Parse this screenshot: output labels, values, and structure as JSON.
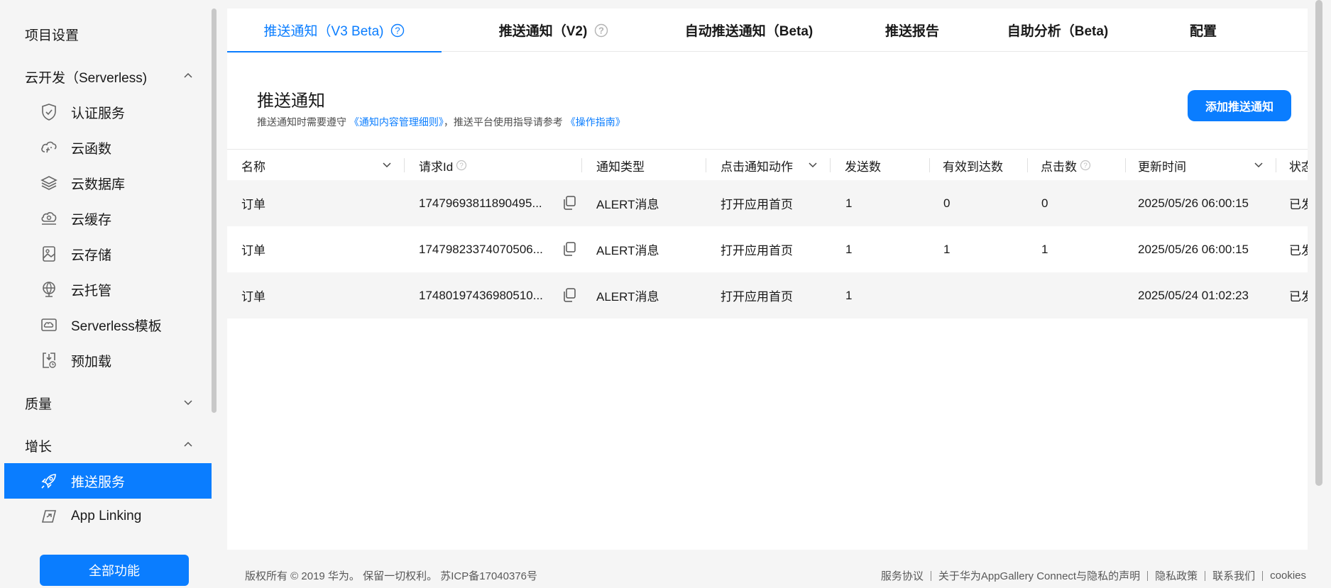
{
  "sidebar": {
    "project_settings": "项目设置",
    "serverless_group": "云开发（Serverless)",
    "items": [
      {
        "label": "认证服务",
        "icon": "shield-check-icon"
      },
      {
        "label": "云函数",
        "icon": "cloud-function-icon"
      },
      {
        "label": "云数据库",
        "icon": "database-layers-icon"
      },
      {
        "label": "云缓存",
        "icon": "cloud-cache-icon"
      },
      {
        "label": "云存储",
        "icon": "storage-image-icon"
      },
      {
        "label": "云托管",
        "icon": "globe-icon"
      },
      {
        "label": "Serverless模板",
        "icon": "template-icon"
      },
      {
        "label": "预加载",
        "icon": "preload-icon"
      }
    ],
    "quality_group": "质量",
    "growth_group": "增长",
    "growth_items": [
      {
        "label": "推送服务",
        "icon": "rocket-icon",
        "active": true
      },
      {
        "label": "App Linking",
        "icon": "app-linking-icon"
      }
    ],
    "all_features": "全部功能"
  },
  "tabs": [
    {
      "label": "推送通知（V3 Beta)",
      "has_help": true,
      "active": true
    },
    {
      "label": "推送通知（V2)",
      "has_help": true
    },
    {
      "label": "自动推送通知（Beta)"
    },
    {
      "label": "推送报告"
    },
    {
      "label": "自助分析（Beta)"
    },
    {
      "label": "配置"
    }
  ],
  "page": {
    "title": "推送通知",
    "subtitle_prefix": "推送通知时需要遵守",
    "subtitle_link1": "《通知内容管理细则》",
    "subtitle_middle": "，推送平台使用指导请参考",
    "subtitle_link2": "《操作指南》",
    "add_button": "添加推送通知"
  },
  "table": {
    "columns": [
      "名称",
      "请求Id",
      "通知类型",
      "点击通知动作",
      "发送数",
      "有效到达数",
      "点击数",
      "更新时间",
      "状态"
    ],
    "rows": [
      {
        "name": "订单",
        "request_id": "17479693811890495...",
        "type": "ALERT消息",
        "action": "打开应用首页",
        "sent": "1",
        "reached": "0",
        "clicks": "0",
        "updated": "2025/05/26 06:00:15",
        "status": "已发"
      },
      {
        "name": "订单",
        "request_id": "17479823374070506...",
        "type": "ALERT消息",
        "action": "打开应用首页",
        "sent": "1",
        "reached": "1",
        "clicks": "1",
        "updated": "2025/05/26 06:00:15",
        "status": "已发"
      },
      {
        "name": "订单",
        "request_id": "17480197436980510...",
        "type": "ALERT消息",
        "action": "打开应用首页",
        "sent": "1",
        "reached": "",
        "clicks": "",
        "updated": "2025/05/24 01:02:23",
        "status": "已发"
      }
    ]
  },
  "footer": {
    "copyright": "版权所有 © 2019 华为。 保留一切权利。 苏ICP备17040376号",
    "links": [
      "服务协议",
      "关于华为AppGallery Connect与隐私的声明",
      "隐私政策",
      "联系我们",
      "cookies"
    ]
  },
  "colors": {
    "accent": "#0a7dff",
    "background": "#f5f5f5",
    "row_alt": "#f5f5f5"
  }
}
